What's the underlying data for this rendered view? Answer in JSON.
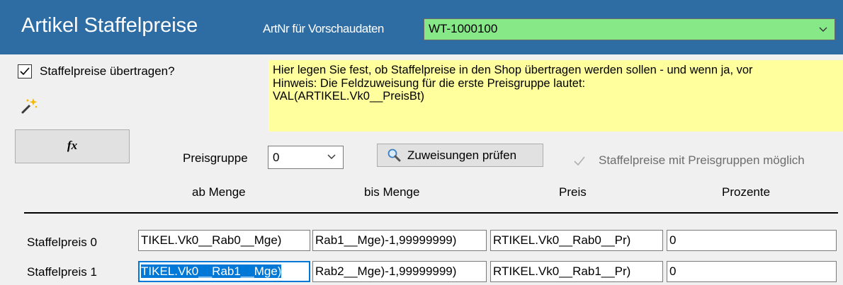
{
  "header": {
    "title": "Artikel Staffelpreise",
    "preview_label": "ArtNr für Vorschaudaten",
    "preview_value": "WT-1000100",
    "preview_color": "#86e886",
    "bg_color": "#2e6da4"
  },
  "options": {
    "transfer_checkbox_label": "Staffelpreise übertragen?",
    "transfer_checked": true,
    "wand_icon": "magic-wand-icon",
    "fx_label": "fx"
  },
  "note": {
    "line1": "Hier legen Sie fest, ob Staffelpreise in den Shop übertragen werden sollen - und wenn ja, vor",
    "line2": "Hinweis: Die Feldzuweisung für die erste Preisgruppe lautet:",
    "line3": "VAL(ARTIKEL.Vk0__PreisBt)",
    "bg_color": "#ffff9e"
  },
  "controls": {
    "price_group_label": "Preisgruppe",
    "price_group_value": "0",
    "check_button_label": "Zuweisungen prüfen",
    "group_checkbox_label": "Staffelpreise mit Preisgruppen möglich",
    "group_checkbox_checked": true
  },
  "table": {
    "columns": [
      "ab Menge",
      "bis Menge",
      "Preis",
      "Prozente"
    ],
    "rows": [
      {
        "label": "Staffelpreis 0",
        "cells": [
          "TIKEL.Vk0__Rab0__Mge)",
          "Rab1__Mge)-1,99999999)",
          "RTIKEL.Vk0__Rab0__Pr)",
          "0"
        ]
      },
      {
        "label": "Staffelpreis 1",
        "cells": [
          "TIKEL.Vk0__Rab1__Mge)",
          "Rab2__Mge)-1,99999999)",
          "RTIKEL.Vk0__Rab1__Pr)",
          "0"
        ]
      }
    ]
  }
}
